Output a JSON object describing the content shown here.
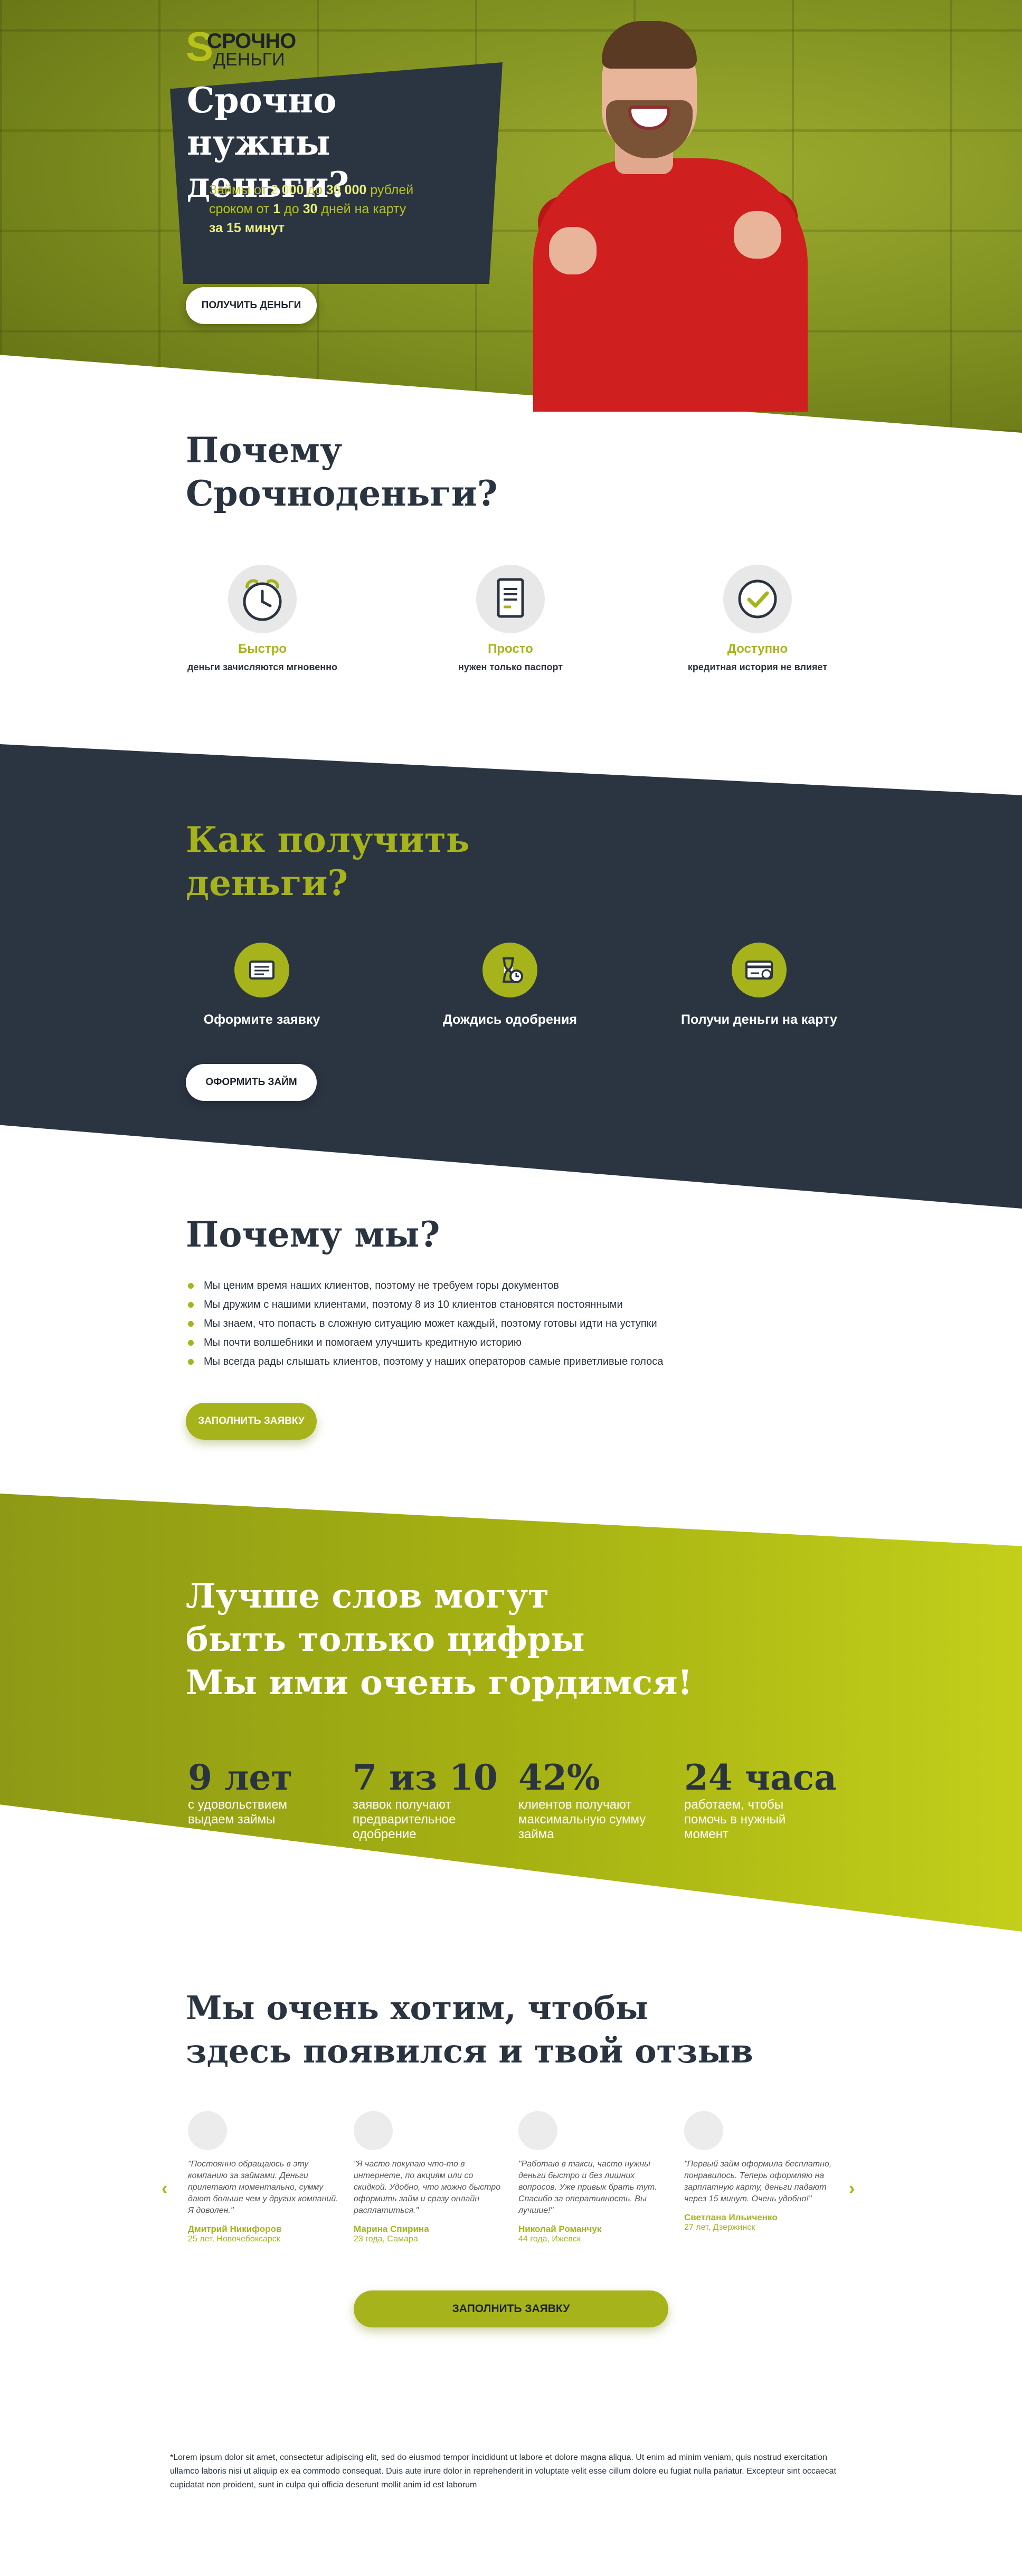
{
  "hero": {
    "logo_line1": "СРОЧНО",
    "logo_line2": "ДЕНЬГИ",
    "title": "Срочно нужны деньги?",
    "sub_line1_pre": "Займы от ",
    "sub_amount_from": "2 000",
    "sub_line1_mid": " до ",
    "sub_amount_to": "30 000",
    "sub_line1_post": " рублей",
    "sub_line2_pre": "сроком от ",
    "sub_days_from": "1",
    "sub_line2_mid": " до ",
    "sub_days_to": "30",
    "sub_line2_post": " дней на карту",
    "sub_line3": "за 15 минут",
    "button": "ПОЛУЧИТЬ ДЕНЬГИ"
  },
  "why_brand": {
    "title_line1": "Почему",
    "title_line2": "Срочноденьги?",
    "features": [
      {
        "icon": "alarm-clock-icon",
        "title": "Быстро",
        "desc": "деньги зачисляются мгновенно"
      },
      {
        "icon": "document-icon",
        "title": "Просто",
        "desc": "нужен только паспорт"
      },
      {
        "icon": "checkmark-icon",
        "title": "Доступно",
        "desc": "кредитная история не влияет"
      }
    ]
  },
  "how": {
    "title_line1": "Как получить",
    "title_line2": "деньги?",
    "steps": [
      {
        "icon": "application-form-icon",
        "label": "Оформите заявку"
      },
      {
        "icon": "hourglass-icon",
        "label": "Дождись одобрения"
      },
      {
        "icon": "card-icon",
        "label": "Получи деньги на карту"
      }
    ],
    "button": "ОФОРМИТЬ ЗАЙМ"
  },
  "why_us": {
    "title": "Почему мы?",
    "items": [
      "Мы ценим время наших клиентов, поэтому не требуем горы документов",
      "Мы дружим с нашими клиентами, поэтому 8 из 10 клиентов становятся постоянными",
      "Мы знаем, что попасть в сложную ситуацию может каждый, поэтому готовы идти на уступки",
      "Мы почти волшебники и помогаем улучшить кредитную историю",
      "Мы всегда рады слышать клиентов, поэтому у наших операторов самые приветливые голоса"
    ],
    "button": "ЗАПОЛНИТЬ ЗАЯВКУ"
  },
  "stats": {
    "title_line1": "Лучше слов могут",
    "title_line2": "быть только цифры",
    "title_line3": "Мы ими очень гордимся!",
    "items": [
      {
        "value": "9 лет",
        "label_l1": "с удовольствием",
        "label_l2": "выдаем займы",
        "label_l3": ""
      },
      {
        "value": "7 из 10",
        "label_l1": "заявок получают",
        "label_l2": "предварительное",
        "label_l3": "одобрение"
      },
      {
        "value": "42%",
        "label_l1": "клиентов получают",
        "label_l2": "максимальную сумму",
        "label_l3": "займа"
      },
      {
        "value": "24 часа",
        "label_l1": "работаем, чтобы",
        "label_l2": "помочь в нужный",
        "label_l3": "момент"
      }
    ]
  },
  "reviews": {
    "title_line1": "Мы очень хотим, чтобы",
    "title_line2": "здесь появился и твой отзыв",
    "items": [
      {
        "text": "\"Постоянно обращаюсь в эту компанию за займами. Деньги прилетают моментально, сумму дают больше чем у других компаний. Я доволен.\"",
        "name": "Дмитрий Никифоров",
        "meta": "25 лет, Новочебоксарск"
      },
      {
        "text": "\"Я часто покупаю что-то в интернете, по акциям или со скидкой. Удобно, что можно быстро оформить займ и сразу онлайн расплатиться.\"",
        "name": "Марина Спирина",
        "meta": "23 года, Самара"
      },
      {
        "text": "\"Работаю в такси, часто нужны деньги быстро и без лишних вопросов. Уже привык брать тут. Спасибо за оперативность. Вы лучшие!\"",
        "name": "Николай Романчук",
        "meta": "44 года, Ижевск"
      },
      {
        "text": "\"Первый займ оформила бесплатно, понравилось. Теперь оформляю на зарплатную карту, деньги падают через 15 минут. Очень удобно!\"",
        "name": "Светлана Ильиченко",
        "meta": "27 лет, Дзержинск"
      }
    ],
    "prev": "‹",
    "next": "›",
    "button": "ЗАПОЛНИТЬ ЗАЯВКУ"
  },
  "footer": {
    "text": "*Lorem ipsum dolor sit amet, consectetur adipiscing elit, sed do eiusmod tempor incididunt ut labore et dolore magna aliqua. Ut enim ad minim veniam, quis nostrud exercitation ullamco laboris nisi ut aliquip ex ea commodo consequat. Duis aute irure dolor in reprehenderit in voluptate velit esse cillum dolore eu fugiat nulla pariatur. Excepteur sint occaecat cupidatat non proident, sunt in culpa qui officia deserunt mollit anim id est laborum"
  },
  "colors": {
    "accent_green": "#a6b31a",
    "dark_navy": "#2b3542",
    "hero_red": "#cf1f1f"
  }
}
